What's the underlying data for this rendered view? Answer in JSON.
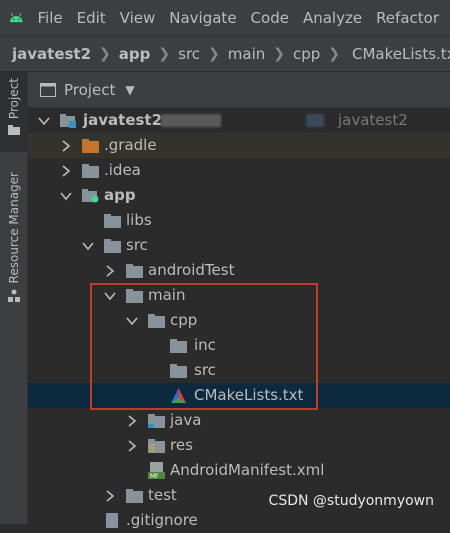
{
  "menubar": {
    "items": [
      "File",
      "Edit",
      "View",
      "Navigate",
      "Code",
      "Analyze",
      "Refactor"
    ]
  },
  "breadcrumb": {
    "items": [
      "javatest2",
      "app",
      "src",
      "main",
      "cpp",
      "CMakeLists.txt"
    ]
  },
  "toolstrip": {
    "tabs": [
      "Project",
      "Resource Manager"
    ]
  },
  "project_panel": {
    "title": "Project"
  },
  "tree": {
    "root_label": "javatest2",
    "root_suffix": "javatest2",
    "rows": [
      ".gradle",
      ".idea",
      "app",
      "libs",
      "src",
      "androidTest",
      "main",
      "cpp",
      "inc",
      "src",
      "CMakeLists.txt",
      "java",
      "res",
      "AndroidManifest.xml",
      "test",
      ".gitignore"
    ]
  },
  "watermark": "CSDN @studyonmyown",
  "colors": {
    "background": "#2b2b2b",
    "chrome": "#3c3f41",
    "selection": "#0d293e",
    "highlight_box": "#c0392b",
    "folder": "#87939a",
    "android_green": "#3ddc84"
  }
}
